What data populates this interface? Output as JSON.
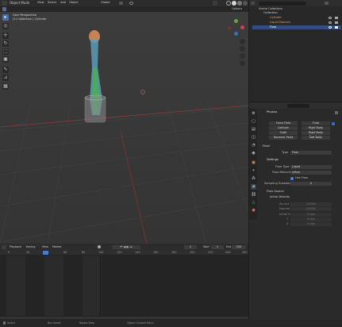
{
  "topbar": {
    "mode": "Object Mode",
    "menus": [
      "View",
      "Select",
      "Add",
      "Object"
    ],
    "orientation": "Global",
    "options": "Options"
  },
  "viewport": {
    "perspective": "User Perspective",
    "collection": "(1) Collection | Cylinder"
  },
  "outliner": {
    "search_placeholder": "",
    "scene_collection": "Scene Collection",
    "collection": "Collection",
    "items": [
      "Cylinder",
      "Liquid Domain",
      "Flow"
    ]
  },
  "properties": {
    "search_placeholder": "",
    "physics_tab": "Physics",
    "buttons_left": [
      "Force Field",
      "Collision",
      "Cloth",
      "Dynamic Paint"
    ],
    "buttons_right": [
      "Fluid",
      "Rigid Body",
      "Rigid Body Constraint",
      "Soft Body"
    ],
    "fluid_header": "Fluid",
    "type_label": "Type",
    "type_value": "Flow",
    "settings_header": "Settings",
    "flow_type_label": "Flow Type",
    "flow_type_value": "Liquid",
    "flow_behavior_label": "Flow Behavior",
    "flow_behavior_value": "Inflow",
    "use_flow_label": "Use Flow",
    "sampling_label": "Sampling Substeps",
    "sampling_value": "0",
    "flow_source_header": "Flow Source",
    "initial_velocity_header": "Initial Velocity",
    "source_label": "Source",
    "source_value": "0.0000",
    "normal_label": "Normal",
    "normal_value": "0.0000",
    "initial_label": "Initial X",
    "x_value": "0 m/s",
    "y_label": "Y",
    "y_value": "0 m/s",
    "z_label": "Z",
    "z_value": "0 m/s"
  },
  "timeline": {
    "menus": [
      "Playback",
      "Keying",
      "View",
      "Marker"
    ],
    "current_frame": "1",
    "start_label": "Start",
    "start_value": "1",
    "end_label": "End",
    "end_value": "250",
    "frames": [
      "0",
      "20",
      "40",
      "60",
      "80",
      "100",
      "120",
      "140",
      "160",
      "180",
      "200",
      "220",
      "240",
      "260"
    ]
  },
  "statusbar": {
    "left": "Select",
    "mid": "Box Select",
    "right": "Rotate View",
    "version": "Object Context Menu"
  }
}
